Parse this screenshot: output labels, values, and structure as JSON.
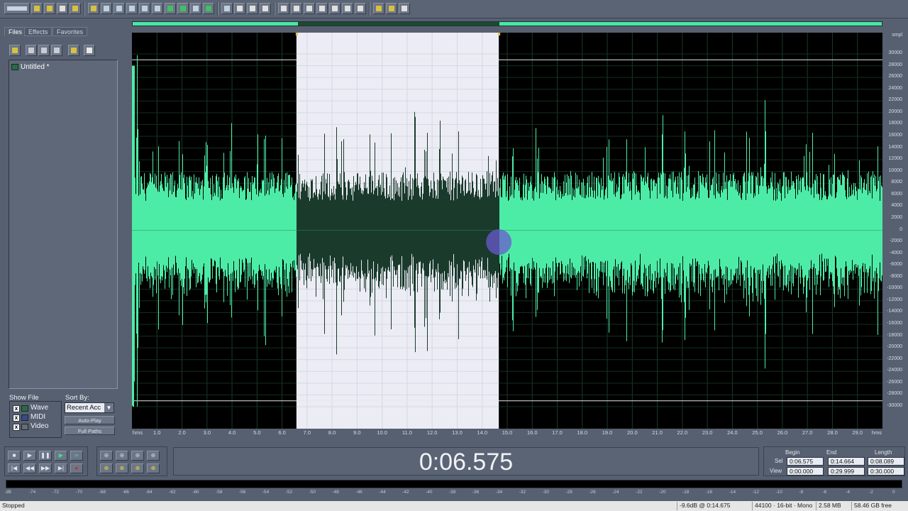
{
  "toolbar": {
    "buttons": [
      "view-toggle-icon",
      "new-file-icon",
      "open-file-icon",
      "save-file-icon",
      "save-all-icon",
      "close-file-icon",
      "undo-icon",
      "redo-icon",
      "cut-icon",
      "copy-icon",
      "paste-icon",
      "mix-paste-icon",
      "trim-icon",
      "silence-icon",
      "insert-icon",
      "edit-view-icon",
      "multitrack-view-icon",
      "cd-view-icon",
      "select-icon",
      "zoom-icon",
      "loop-icon",
      "punch-icon",
      "marker-icon",
      "snap-icon",
      "playlist-icon",
      "region-icon",
      "info-icon",
      "settings-icon",
      "help-icon"
    ]
  },
  "left_panel": {
    "tabs": [
      "Files",
      "Effects",
      "Favorites"
    ],
    "active_tab": "Files",
    "file_toolbar": [
      "open-folder-icon",
      "close-file-icon",
      "insert-icon",
      "import-icon",
      "properties-icon",
      "help-icon"
    ],
    "files": [
      {
        "name": "Untitled *"
      }
    ],
    "show_file_label": "Show File",
    "show_options": [
      {
        "label": "Wave",
        "checked": true
      },
      {
        "label": "MIDI",
        "checked": true
      },
      {
        "label": "Video",
        "checked": true
      }
    ],
    "sort_by_label": "Sort By:",
    "sort_by_value": "Recent Acc",
    "auto_play_label": "Auto-Play",
    "full_paths_label": "Full Paths"
  },
  "waveform": {
    "amplitude_unit": "smpl",
    "amplitude_ticks": [
      "30000",
      "28000",
      "26000",
      "24000",
      "22000",
      "20000",
      "18000",
      "16000",
      "14000",
      "12000",
      "10000",
      "8000",
      "6000",
      "4000",
      "2000",
      "0",
      "-2000",
      "-4000",
      "-6000",
      "-8000",
      "-10000",
      "-12000",
      "-14000",
      "-16000",
      "-18000",
      "-20000",
      "-22000",
      "-24000",
      "-26000",
      "-28000",
      "-30000"
    ],
    "time_unit": "hms",
    "time_ticks": [
      "1.0",
      "2.0",
      "3.0",
      "4.0",
      "5.0",
      "6.0",
      "7.0",
      "8.0",
      "9.0",
      "10.0",
      "11.0",
      "12.0",
      "13.0",
      "14.0",
      "15.0",
      "16.0",
      "17.0",
      "18.0",
      "19.0",
      "20.0",
      "21.0",
      "22.0",
      "23.0",
      "24.0",
      "25.0",
      "26.0",
      "27.0",
      "28.0",
      "29.0"
    ],
    "view_seconds": 30.0,
    "selection_start_s": 6.575,
    "selection_end_s": 14.664,
    "wave_color": "#4deca6",
    "selected_wave_color": "#1a3a2c",
    "selection_bg": "#ecedf4",
    "background": "#000000"
  },
  "transport": {
    "buttons": [
      "stop-icon",
      "play-icon",
      "pause-icon",
      "play-to-end-icon",
      "loop-play-icon",
      "go-to-start-icon",
      "rewind-icon",
      "fast-forward-icon",
      "go-to-end-icon",
      "record-icon"
    ],
    "zoom_buttons": [
      "zoom-in-h-icon",
      "zoom-out-h-icon",
      "zoom-full-icon",
      "zoom-in-v-icon",
      "zoom-selection-icon",
      "zoom-left-icon",
      "zoom-right-icon",
      "zoom-out-v-icon"
    ],
    "time_display": "0:06.575"
  },
  "selection_panel": {
    "headers": {
      "begin": "Begin",
      "end": "End",
      "length": "Length"
    },
    "rows": [
      {
        "label": "Sel",
        "begin": "0:06.575",
        "end": "0:14.664",
        "length": "0:08.089"
      },
      {
        "label": "View",
        "begin": "0:00.000",
        "end": "0:29.999",
        "length": "0:30.000"
      }
    ]
  },
  "level_meter": {
    "scale": [
      "dB",
      "-74",
      "-72",
      "-70",
      "-68",
      "-66",
      "-64",
      "-62",
      "-60",
      "-58",
      "-56",
      "-54",
      "-52",
      "-50",
      "-48",
      "-46",
      "-44",
      "-42",
      "-40",
      "-38",
      "-36",
      "-34",
      "-32",
      "-30",
      "-28",
      "-26",
      "-24",
      "-22",
      "-20",
      "-18",
      "-16",
      "-14",
      "-12",
      "-10",
      "-8",
      "-6",
      "-4",
      "-2",
      "0"
    ]
  },
  "status_bar": {
    "state": "Stopped",
    "cursor": "-9.6dB @ 0:14.675",
    "format": "44100 · 16-bit · Mono",
    "size": "2.58 MB",
    "free": "58.46 GB free"
  }
}
